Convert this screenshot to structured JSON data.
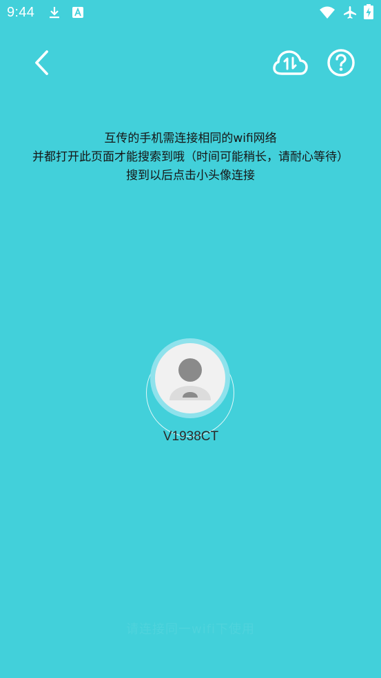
{
  "status_bar": {
    "time": "9:44",
    "icons": [
      "download-icon",
      "app-a-icon",
      "wifi-icon",
      "airplane-icon",
      "battery-charging-icon"
    ]
  },
  "nav": {
    "back_icon": "chevron-left-icon",
    "transfer_icon": "cloud-transfer-icon",
    "help_icon": "help-circle-icon"
  },
  "instructions": {
    "line1": "互传的手机需连接相同的wifi网络",
    "line2": "并都打开此页面才能搜索到哦（时间可能稍长，请耐心等待）",
    "line3": "搜到以后点击小头像连接"
  },
  "device": {
    "name": "V1938CT",
    "avatar_icon": "person-avatar-icon"
  },
  "footer": {
    "hint": "请连接同一wifi下使用"
  },
  "colors": {
    "background": "#42D0DA",
    "halo": "#8FE2EC",
    "avatar_bg": "#F1F1F1"
  }
}
